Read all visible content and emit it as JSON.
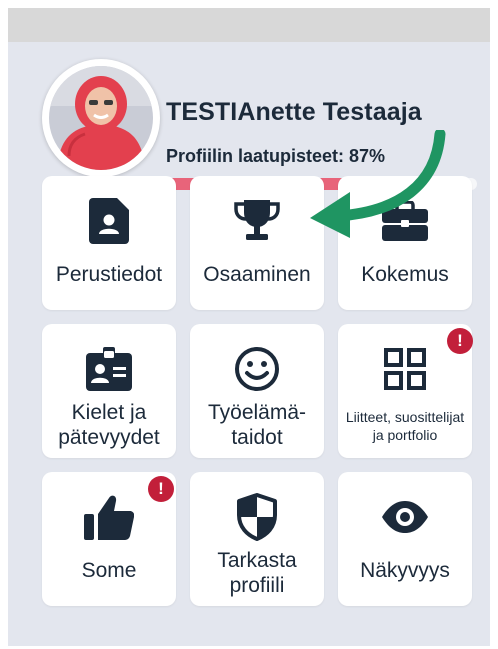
{
  "profile": {
    "name": "TESTIAnette Testaaja",
    "score_label": "Profiilin laatupisteet: 87%",
    "score_fraction": 0.87
  },
  "colors": {
    "progress": "#e8647a",
    "badge": "#c21f3a",
    "arrow": "#1f9562",
    "icon": "#1c2a3a",
    "panel": "#e3e6ee"
  },
  "tiles": [
    {
      "label": "Perustiedot",
      "icon": "contact-card-icon"
    },
    {
      "label": "Osaaminen",
      "icon": "trophy-icon"
    },
    {
      "label": "Kokemus",
      "icon": "briefcase-icon"
    },
    {
      "label": "Kielet ja pätevyydet",
      "icon": "id-badge-icon"
    },
    {
      "label": "Työelämä-taidot",
      "icon": "smiley-icon"
    },
    {
      "label": "Liitteet, suosittelijat ja portfolio",
      "icon": "grid-icon",
      "badge": "!"
    },
    {
      "label": "Some",
      "icon": "thumbs-up-icon",
      "badge": "!"
    },
    {
      "label": "Tarkasta profiili",
      "icon": "shield-icon"
    },
    {
      "label": "Näkyvyys",
      "icon": "eye-icon"
    }
  ]
}
